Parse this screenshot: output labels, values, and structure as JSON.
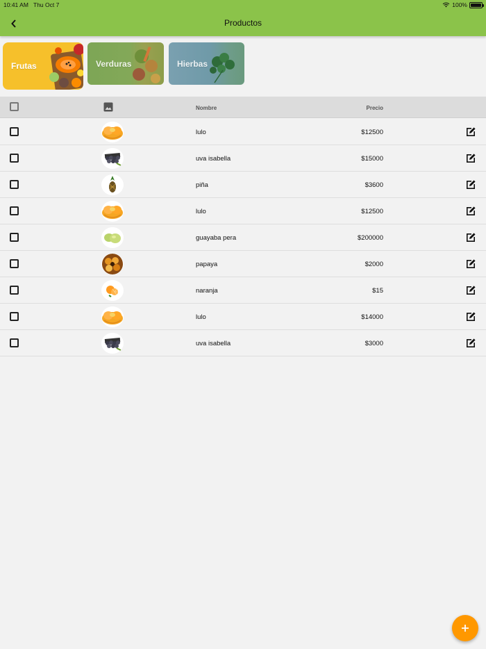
{
  "status_bar": {
    "time": "10:41 AM",
    "date": "Thu Oct 7",
    "battery": "100%"
  },
  "app_bar": {
    "title": "Productos"
  },
  "categories": [
    {
      "label": "Frutas",
      "selected": true
    },
    {
      "label": "Verduras",
      "selected": false
    },
    {
      "label": "Hierbas",
      "selected": false
    }
  ],
  "table": {
    "headers": {
      "name": "Nombre",
      "price": "Precio"
    },
    "rows": [
      {
        "name": "lulo",
        "price": "$12500",
        "image": "lulo-image"
      },
      {
        "name": "uva isabella",
        "price": "$15000",
        "image": "grapes-image"
      },
      {
        "name": "piña",
        "price": "$3600",
        "image": "pineapple-image"
      },
      {
        "name": "lulo",
        "price": "$12500",
        "image": "lulo-image"
      },
      {
        "name": "guayaba pera",
        "price": "$200000",
        "image": "guava-image"
      },
      {
        "name": "papaya",
        "price": "$2000",
        "image": "papaya-image"
      },
      {
        "name": "naranja",
        "price": "$15",
        "image": "orange-image"
      },
      {
        "name": "lulo",
        "price": "$14000",
        "image": "lulo-image"
      },
      {
        "name": "uva isabella",
        "price": "$3000",
        "image": "grapes-image"
      }
    ]
  },
  "colors": {
    "appbar": "#8bc34a",
    "fab": "#ff9800",
    "frutas_card": "#f6c02b"
  },
  "icons": {
    "back": "chevron-left-icon",
    "image_header": "image-icon",
    "edit": "edit-icon",
    "fab": "plus-icon",
    "wifi": "wifi-icon",
    "battery": "battery-icon"
  }
}
